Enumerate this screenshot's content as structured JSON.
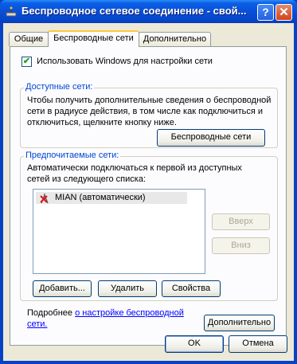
{
  "window": {
    "title": "Беспроводное сетевое соединение - свой...",
    "help_label": "?",
    "close_label": "✕"
  },
  "tabs": [
    {
      "label": "Общие"
    },
    {
      "label": "Беспроводные сети"
    },
    {
      "label": "Дополнительно"
    }
  ],
  "use_windows": {
    "checked": true,
    "label": "Использовать Windows для настройки сети"
  },
  "available": {
    "legend": "Доступные сети:",
    "description_lines": [
      "Чтобы получить дополнительные сведения о беспроводной",
      "сети в радиусе действия, в том числе как подключиться и",
      "отключиться, щелкните кнопку ниже."
    ],
    "button_label": "Беспроводные сети"
  },
  "preferred": {
    "legend": "Предпочитаемые сети:",
    "description_lines": [
      "Автоматически подключаться к первой из доступных",
      "сетей из следующего списка:"
    ],
    "networks": [
      {
        "name": "MIAN (автоматически)",
        "icon": "antenna-icon"
      }
    ],
    "up_label": "Вверх",
    "down_label": "Вниз",
    "add_label": "Добавить...",
    "remove_label": "Удалить",
    "properties_label": "Свойства"
  },
  "more_info": {
    "prefix": "Подробнее ",
    "link_line1": "о настройке беспроводной",
    "link_line2": "сети.",
    "advanced_label": "Дополнительно"
  },
  "footer": {
    "ok_label": "OK",
    "cancel_label": "Отмена"
  }
}
